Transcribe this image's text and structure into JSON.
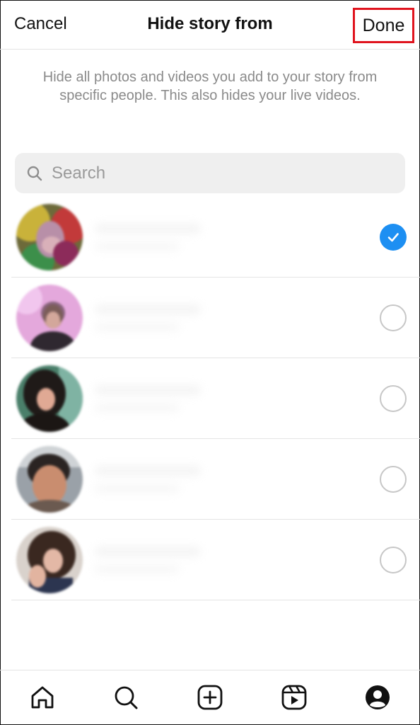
{
  "header": {
    "cancel_label": "Cancel",
    "title": "Hide story from",
    "done_label": "Done"
  },
  "description": "Hide all photos and videos you add to your story from specific people. This also hides your live videos.",
  "search": {
    "placeholder": "Search",
    "value": ""
  },
  "accounts": [
    {
      "selected": true
    },
    {
      "selected": false
    },
    {
      "selected": false
    },
    {
      "selected": false
    },
    {
      "selected": false
    }
  ],
  "colors": {
    "accent": "#1d8ff2",
    "highlight_box": "#e0141e",
    "divider": "#e4e4e4",
    "secondary_text": "#8a8a8a"
  },
  "tabbar": {
    "icons": [
      "home-icon",
      "search-icon",
      "create-icon",
      "reels-icon",
      "profile-icon"
    ]
  }
}
